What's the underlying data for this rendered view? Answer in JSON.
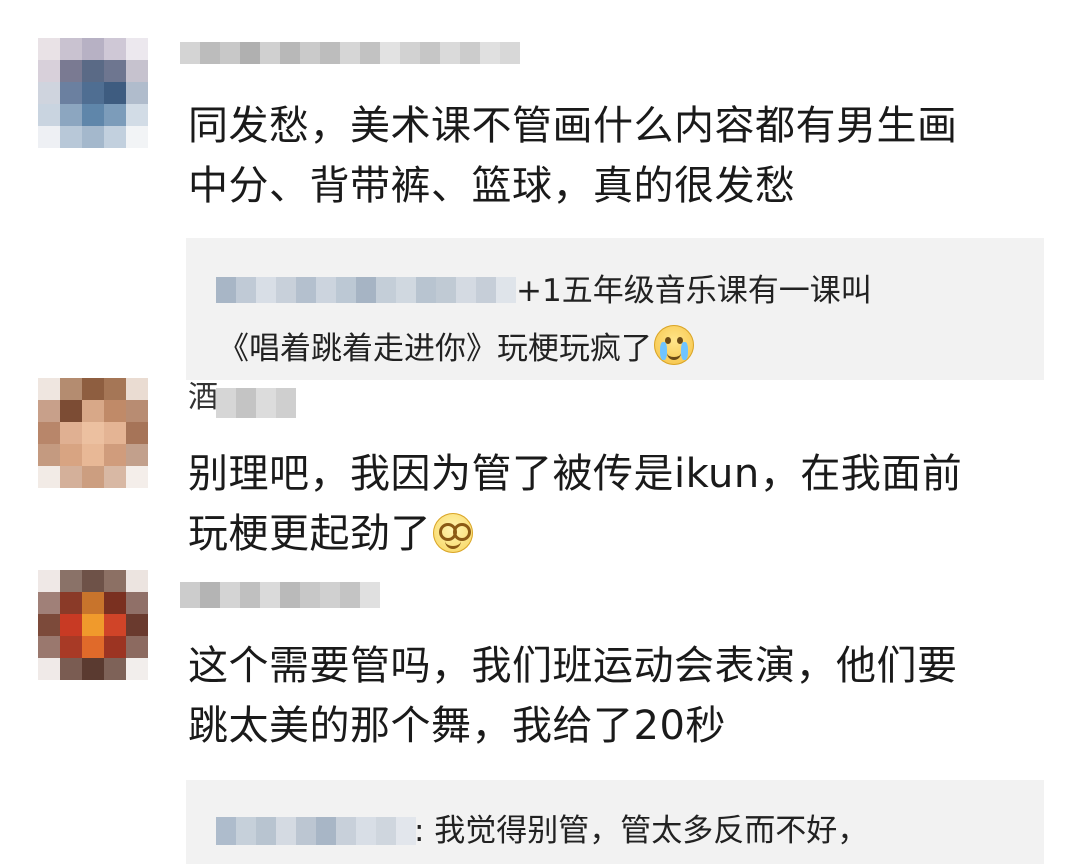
{
  "comments": [
    {
      "lines": [
        "同发愁，美术课不管画什么内容都有男生画",
        "中分、背带裤、篮球，真的很发愁"
      ],
      "reply": {
        "suffix": "+1五年级音乐课有一课叫",
        "line2": "《唱着跳着走进你》玩梗玩疯了",
        "emoji": "crying-face-icon"
      }
    },
    {
      "name_char": "酒",
      "lines": [
        "别理吧，我因为管了被传是ikun，在我面前",
        "玩梗更起劲了"
      ],
      "emoji": "dizzy-smile-icon"
    },
    {
      "lines": [
        "这个需要管吗，我们班运动会表演，他们要",
        "跳太美的那个舞，我给了20秒"
      ],
      "reply": {
        "suffix": ": 我觉得别管，管太多反而不好，"
      }
    }
  ],
  "colors": {
    "text": "#1a1a1a",
    "reply_bg": "#f2f2f2"
  }
}
